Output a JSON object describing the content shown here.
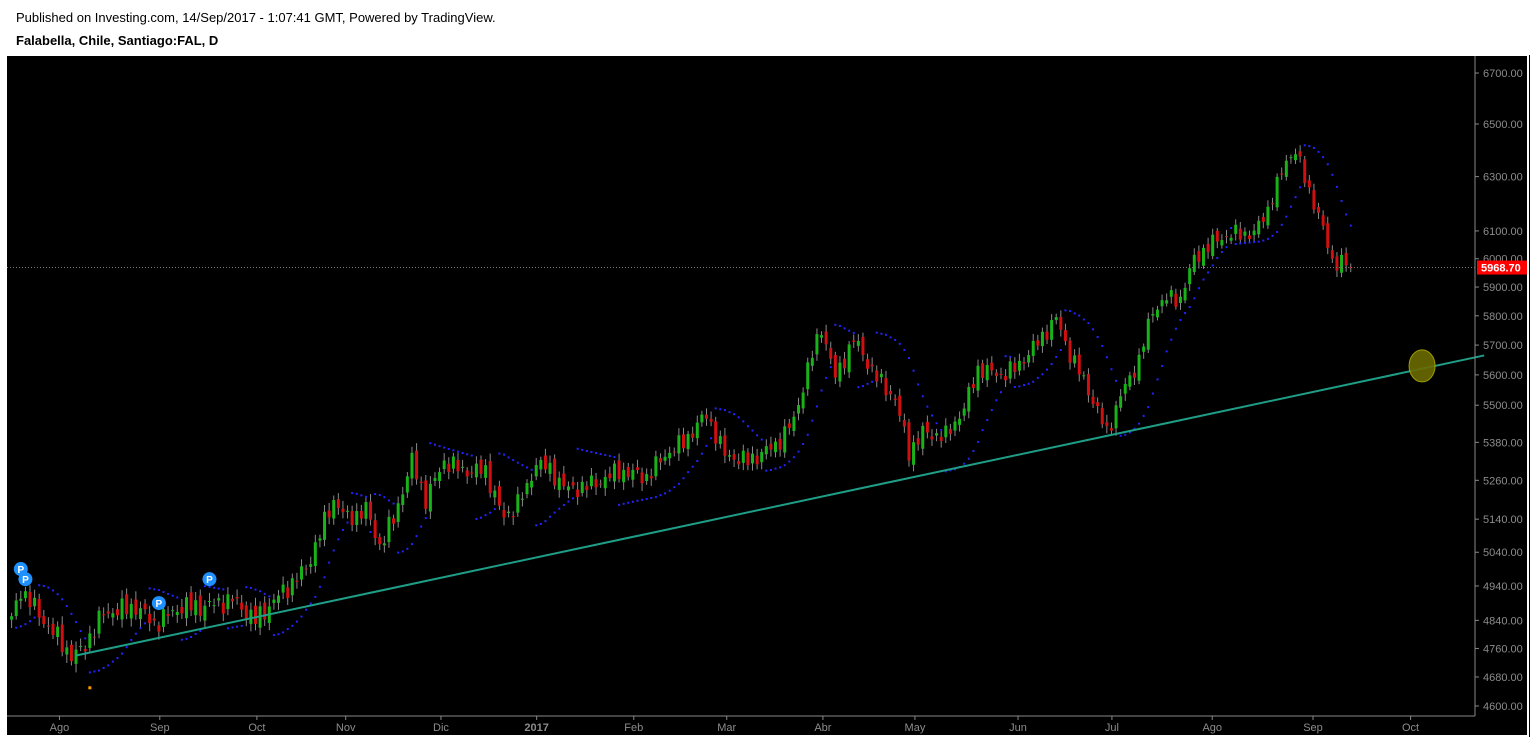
{
  "header": {
    "published": "Published on Investing.com, 14/Sep/2017 - 1:07:41 GMT, Powered by TradingView.",
    "symbol": "Falabella, Chile, Santiago:FAL, D"
  },
  "chart_data": {
    "type": "candlestick",
    "title": "Falabella, Chile, Santiago:FAL, D",
    "scale": "log",
    "ylim": [
      4600,
      6700
    ],
    "y_ticks": [
      "6700.00",
      "6500.00",
      "6300.00",
      "6100.00",
      "6000.00",
      "5900.00",
      "5800.00",
      "5700.00",
      "5600.00",
      "5500.00",
      "5380.00",
      "5260.00",
      "5140.00",
      "5040.00",
      "4940.00",
      "4840.00",
      "4760.00",
      "4680.00",
      "4600.00"
    ],
    "x_ticks": [
      {
        "label": "Ago",
        "day": 10.4
      },
      {
        "label": "Sep",
        "day": 32.2
      },
      {
        "label": "Oct",
        "day": 53.3
      },
      {
        "label": "Nov",
        "day": 72.6
      },
      {
        "label": "Dic",
        "day": 93.3
      },
      {
        "label": "2017",
        "day": 114.1
      },
      {
        "label": "Feb",
        "day": 135.2
      },
      {
        "label": "Mar",
        "day": 155.4
      },
      {
        "label": "Abr",
        "day": 176.3
      },
      {
        "label": "May",
        "day": 196.3
      },
      {
        "label": "Jun",
        "day": 218.7
      },
      {
        "label": "Jul",
        "day": 239.1
      },
      {
        "label": "Ago",
        "day": 260.9
      },
      {
        "label": "Sep",
        "day": 282.8
      },
      {
        "label": "Oct",
        "day": 304
      }
    ],
    "x_range_days": [
      -1,
      318
    ],
    "close_anchors": [
      [
        0,
        4840
      ],
      [
        2,
        4930
      ],
      [
        7,
        4840
      ],
      [
        13,
        4740
      ],
      [
        15,
        4750
      ],
      [
        20,
        4860
      ],
      [
        27,
        4880
      ],
      [
        31,
        4830
      ],
      [
        37,
        4880
      ],
      [
        42,
        4880
      ],
      [
        48,
        4900
      ],
      [
        53,
        4840
      ],
      [
        58,
        4910
      ],
      [
        64,
        4990
      ],
      [
        70,
        5200
      ],
      [
        73,
        5140
      ],
      [
        77,
        5170
      ],
      [
        80,
        5060
      ],
      [
        83,
        5140
      ],
      [
        87,
        5320
      ],
      [
        90,
        5200
      ],
      [
        94,
        5320
      ],
      [
        98,
        5290
      ],
      [
        103,
        5290
      ],
      [
        107,
        5140
      ],
      [
        112,
        5230
      ],
      [
        114,
        5320
      ],
      [
        117,
        5290
      ],
      [
        121,
        5230
      ],
      [
        127,
        5250
      ],
      [
        132,
        5290
      ],
      [
        138,
        5270
      ],
      [
        142,
        5340
      ],
      [
        146,
        5380
      ],
      [
        151,
        5470
      ],
      [
        155,
        5340
      ],
      [
        160,
        5320
      ],
      [
        166,
        5370
      ],
      [
        170,
        5450
      ],
      [
        173,
        5620
      ],
      [
        176,
        5760
      ],
      [
        179,
        5590
      ],
      [
        183,
        5720
      ],
      [
        188,
        5590
      ],
      [
        192,
        5520
      ],
      [
        195,
        5350
      ],
      [
        198,
        5410
      ],
      [
        203,
        5400
      ],
      [
        207,
        5490
      ],
      [
        210,
        5620
      ],
      [
        215,
        5600
      ],
      [
        218,
        5620
      ],
      [
        222,
        5690
      ],
      [
        227,
        5790
      ],
      [
        230,
        5670
      ],
      [
        234,
        5550
      ],
      [
        238,
        5410
      ],
      [
        241,
        5530
      ],
      [
        245,
        5650
      ],
      [
        248,
        5820
      ],
      [
        251,
        5860
      ],
      [
        254,
        5860
      ],
      [
        257,
        6000
      ],
      [
        262,
        6070
      ],
      [
        266,
        6090
      ],
      [
        270,
        6090
      ],
      [
        273,
        6180
      ],
      [
        277,
        6360
      ],
      [
        279,
        6400
      ],
      [
        281,
        6290
      ],
      [
        284,
        6160
      ],
      [
        287,
        5990
      ],
      [
        289,
        5990
      ],
      [
        291,
        5968.7
      ]
    ],
    "last_price": "5968.70",
    "trendline": {
      "start": [
        14,
        4740
      ],
      "end": [
        320,
        5665
      ]
    },
    "highlight_ellipse": {
      "day": 306.5,
      "price": 5630
    },
    "pivot_markers": [
      {
        "label": "P",
        "day": 2,
        "price": 4990
      },
      {
        "label": "P",
        "day": 3,
        "price": 4960
      },
      {
        "label": "P",
        "day": 32,
        "price": 4890
      },
      {
        "label": "P",
        "day": 43,
        "price": 4960
      }
    ],
    "indicator": "Parabolic SAR",
    "colors": {
      "up": "#19b219",
      "down": "#d01010",
      "wick": "#8a8a8a",
      "sar": "#2323ff",
      "trend": "#1e9e86",
      "last": "#ff0000",
      "ellipse": "#6b6b00",
      "marker": "#1e90ff"
    }
  }
}
